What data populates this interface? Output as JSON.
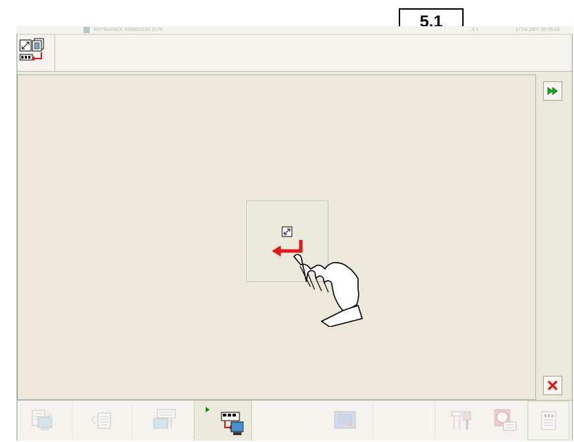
{
  "section_number": "5.1",
  "titlebar": {
    "machine_name": "ENTRAPACK 4256KDZ45 JU78",
    "version": "4.1",
    "datetime": "17.04.2007 08:05:45"
  },
  "icons": {
    "header": "home-screen-return-icon",
    "forward": "double-arrow-right-icon",
    "close": "close-x-icon",
    "center": "return-to-home-icon",
    "hand": "pointing-hand-icon"
  },
  "colors": {
    "accent_green": "#1ea81e",
    "close_red": "#e01818",
    "arrow_red": "#e01818",
    "panel_beige": "#ece9dd"
  },
  "taskbar": {
    "buttons": [
      {
        "name": "production-screen",
        "state": "disabled"
      },
      {
        "name": "format-selection",
        "state": "disabled"
      },
      {
        "name": "format-transfer",
        "state": "disabled"
      },
      {
        "name": "screen-navigation",
        "state": "active"
      },
      {
        "name": "machine-overview",
        "state": "disabled"
      },
      {
        "name": "diagnostics-tools",
        "state": "disabled"
      },
      {
        "name": "alarm-messages",
        "state": "disabled"
      },
      {
        "name": "settings-panel",
        "state": "disabled"
      }
    ]
  }
}
